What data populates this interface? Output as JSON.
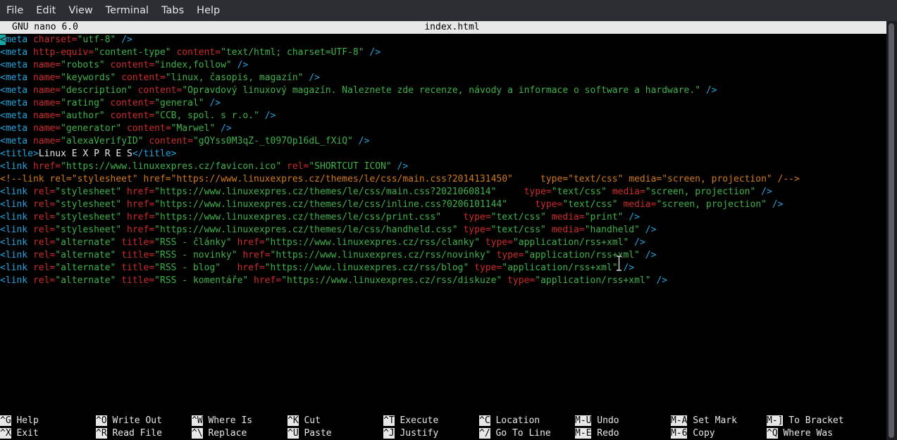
{
  "menubar": {
    "items": [
      "File",
      "Edit",
      "View",
      "Terminal",
      "Tabs",
      "Help"
    ]
  },
  "nano": {
    "app_version": "GNU nano 6.0",
    "file_name": "index.html"
  },
  "editor_lines": [
    [
      [
        "t",
        "<"
      ],
      [
        "t",
        "meta "
      ],
      [
        "a",
        "charset="
      ],
      [
        "s",
        "\"utf-8\""
      ],
      [
        "t",
        " />"
      ]
    ],
    [
      [
        "t",
        "<meta "
      ],
      [
        "a",
        "http-equiv="
      ],
      [
        "s",
        "\"content-type\""
      ],
      [
        "a",
        " content="
      ],
      [
        "s",
        "\"text/html; charset=UTF-8\""
      ],
      [
        "t",
        " />"
      ]
    ],
    [
      [
        "t",
        "<meta "
      ],
      [
        "a",
        "name="
      ],
      [
        "s",
        "\"robots\""
      ],
      [
        "a",
        " content="
      ],
      [
        "s",
        "\"index,follow\""
      ],
      [
        "t",
        " />"
      ]
    ],
    [
      [
        "t",
        "<meta "
      ],
      [
        "a",
        "name="
      ],
      [
        "s",
        "\"keywords\""
      ],
      [
        "a",
        " content="
      ],
      [
        "s",
        "\"linux, časopis, magazín\""
      ],
      [
        "t",
        " />"
      ]
    ],
    [
      [
        "t",
        "<meta "
      ],
      [
        "a",
        "name="
      ],
      [
        "s",
        "\"description\""
      ],
      [
        "a",
        " content="
      ],
      [
        "s",
        "\"Opravdový linuxový magazín. Naleznete zde recenze, návody a informace o software a hardware.\""
      ],
      [
        "t",
        " />"
      ]
    ],
    [
      [
        "t",
        "<meta "
      ],
      [
        "a",
        "name="
      ],
      [
        "s",
        "\"rating\""
      ],
      [
        "a",
        " content="
      ],
      [
        "s",
        "\"general\""
      ],
      [
        "t",
        " />"
      ]
    ],
    [
      [
        "t",
        "<meta "
      ],
      [
        "a",
        "name="
      ],
      [
        "s",
        "\"author\""
      ],
      [
        "a",
        " content="
      ],
      [
        "s",
        "\"CCB, spol. s r.o.\""
      ],
      [
        "t",
        " />"
      ]
    ],
    [
      [
        "t",
        "<meta "
      ],
      [
        "a",
        "name="
      ],
      [
        "s",
        "\"generator\""
      ],
      [
        "a",
        " content="
      ],
      [
        "s",
        "\"Marwel\""
      ],
      [
        "t",
        " />"
      ]
    ],
    [
      [
        "t",
        "<meta "
      ],
      [
        "a",
        "name="
      ],
      [
        "s",
        "\"alexaVerifyID\""
      ],
      [
        "a",
        " content="
      ],
      [
        "s",
        "\"gQYss0M3qZ-_t097Op16dL_fXiQ\""
      ],
      [
        "t",
        " />"
      ]
    ],
    [
      [
        "t",
        "<title>"
      ],
      [
        "x",
        "Linux E X P R E S"
      ],
      [
        "t",
        "</title>"
      ]
    ],
    [
      [
        "t",
        "<link "
      ],
      [
        "a",
        "href="
      ],
      [
        "s",
        "\"https://www.linuxexpres.cz/favicon.ico\""
      ],
      [
        "a",
        " rel="
      ],
      [
        "s",
        "\"SHORTCUT ICON\""
      ],
      [
        "t",
        " />"
      ]
    ],
    [
      [
        "c",
        "<!--link rel=\"stylesheet\" href=\"https://www.linuxexpres.cz/themes/le/css/main.css?2014131450\"     type=\"text/css\" media=\"screen, projection\" /-->"
      ]
    ],
    [
      [
        "t",
        "<link "
      ],
      [
        "a",
        "rel="
      ],
      [
        "s",
        "\"stylesheet\""
      ],
      [
        "a",
        " href="
      ],
      [
        "s",
        "\"https://www.linuxexpres.cz/themes/le/css/main.css?2021060814\""
      ],
      [
        "a",
        "     type="
      ],
      [
        "s",
        "\"text/css\""
      ],
      [
        "a",
        " media="
      ],
      [
        "s",
        "\"screen, projection\""
      ],
      [
        "t",
        " />"
      ]
    ],
    [
      [
        "t",
        "<link "
      ],
      [
        "a",
        "rel="
      ],
      [
        "s",
        "\"stylesheet\""
      ],
      [
        "a",
        " href="
      ],
      [
        "s",
        "\"https://www.linuxexpres.cz/themes/le/css/inline.css?0206101144\""
      ],
      [
        "a",
        "     type="
      ],
      [
        "s",
        "\"text/css\""
      ],
      [
        "a",
        " media="
      ],
      [
        "s",
        "\"screen, projection\""
      ],
      [
        "t",
        " />"
      ]
    ],
    [
      [
        "t",
        "<link "
      ],
      [
        "a",
        "rel="
      ],
      [
        "s",
        "\"stylesheet\""
      ],
      [
        "a",
        " href="
      ],
      [
        "s",
        "\"https://www.linuxexpres.cz/themes/le/css/print.css\""
      ],
      [
        "a",
        "    type="
      ],
      [
        "s",
        "\"text/css\""
      ],
      [
        "a",
        " media="
      ],
      [
        "s",
        "\"print\""
      ],
      [
        "t",
        " />"
      ]
    ],
    [
      [
        "t",
        "<link "
      ],
      [
        "a",
        "rel="
      ],
      [
        "s",
        "\"stylesheet\""
      ],
      [
        "a",
        " href="
      ],
      [
        "s",
        "\"https://www.linuxexpres.cz/themes/le/css/handheld.css\""
      ],
      [
        "a",
        " type="
      ],
      [
        "s",
        "\"text/css\""
      ],
      [
        "a",
        " media="
      ],
      [
        "s",
        "\"handheld\""
      ],
      [
        "t",
        " />"
      ]
    ],
    [
      [
        "t",
        "<link "
      ],
      [
        "a",
        "rel="
      ],
      [
        "s",
        "\"alternate\""
      ],
      [
        "a",
        " title="
      ],
      [
        "s",
        "\"RSS - články\""
      ],
      [
        "a",
        " href="
      ],
      [
        "s",
        "\"https://www.linuxexpres.cz/rss/clanky\""
      ],
      [
        "a",
        " type="
      ],
      [
        "s",
        "\"application/rss+xml\""
      ],
      [
        "t",
        " />"
      ]
    ],
    [
      [
        "t",
        "<link "
      ],
      [
        "a",
        "rel="
      ],
      [
        "s",
        "\"alternate\""
      ],
      [
        "a",
        " title="
      ],
      [
        "s",
        "\"RSS - novinky\""
      ],
      [
        "a",
        " href="
      ],
      [
        "s",
        "\"https://www.linuxexpres.cz/rss/novinky\""
      ],
      [
        "a",
        " type="
      ],
      [
        "s",
        "\"application/rss+xml\""
      ],
      [
        "t",
        " />"
      ]
    ],
    [
      [
        "t",
        "<link "
      ],
      [
        "a",
        "rel="
      ],
      [
        "s",
        "\"alternate\""
      ],
      [
        "a",
        " title="
      ],
      [
        "s",
        "\"RSS - blog\""
      ],
      [
        "a",
        "   href="
      ],
      [
        "s",
        "\"https://www.linuxexpres.cz/rss/blog\""
      ],
      [
        "a",
        " type="
      ],
      [
        "s",
        "\"application/rss+xml\""
      ],
      [
        "t",
        " />"
      ]
    ],
    [
      [
        "t",
        "<link "
      ],
      [
        "a",
        "rel="
      ],
      [
        "s",
        "\"alternate\""
      ],
      [
        "a",
        " title="
      ],
      [
        "s",
        "\"RSS - komentáře\""
      ],
      [
        "a",
        " href="
      ],
      [
        "s",
        "\"https://www.linuxexpres.cz/rss/diskuze\""
      ],
      [
        "a",
        " type="
      ],
      [
        "s",
        "\"application/rss+xml\""
      ],
      [
        "t",
        " />"
      ]
    ]
  ],
  "shortcuts": [
    {
      "key": "^G",
      "label": " Help"
    },
    {
      "key": "^X",
      "label": " Exit"
    },
    {
      "key": "^O",
      "label": " Write Out"
    },
    {
      "key": "^R",
      "label": " Read File"
    },
    {
      "key": "^W",
      "label": " Where Is"
    },
    {
      "key": "^\\",
      "label": " Replace"
    },
    {
      "key": "^K",
      "label": " Cut"
    },
    {
      "key": "^U",
      "label": " Paste"
    },
    {
      "key": "^T",
      "label": " Execute"
    },
    {
      "key": "^J",
      "label": " Justify"
    },
    {
      "key": "^C",
      "label": " Location"
    },
    {
      "key": "^/",
      "label": " Go To Line"
    },
    {
      "key": "M-U",
      "label": " Undo"
    },
    {
      "key": "M-E",
      "label": " Redo"
    },
    {
      "key": "M-A",
      "label": " Set Mark"
    },
    {
      "key": "M-6",
      "label": " Copy"
    },
    {
      "key": "M-]",
      "label": " To Bracket"
    },
    {
      "key": "^Q",
      "label": " Where Was"
    }
  ],
  "colors": {
    "tag": "#23a3dd",
    "attribute": "#cd2b2b",
    "string": "#3fb24b",
    "comment": "#d07a1c",
    "text": "#e8e8e8",
    "cursor": "#1aa5a5"
  },
  "icons": {
    "mouse_pointer": "text-cursor-ibeam-icon"
  }
}
